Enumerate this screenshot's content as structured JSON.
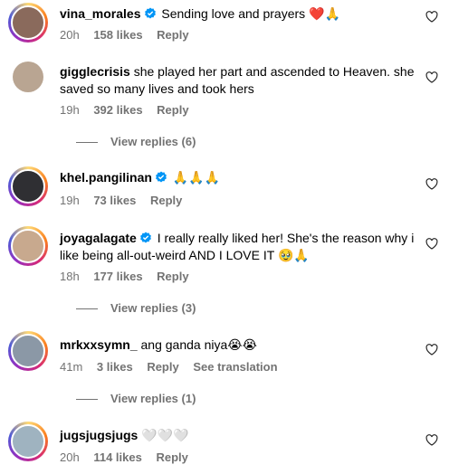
{
  "comments": [
    {
      "username": "vina_morales",
      "verified": true,
      "text": "Sending love and prayers",
      "emoji": "❤️🙏",
      "time": "20h",
      "likes": "158 likes",
      "reply": "Reply",
      "story_ring": true,
      "avatar_color": "#8a6a5c"
    },
    {
      "username": "gigglecrisis",
      "verified": false,
      "text": "she played her part and ascended to Heaven. she saved so many lives and took hers",
      "emoji": "",
      "time": "19h",
      "likes": "392 likes",
      "reply": "Reply",
      "story_ring": false,
      "avatar_color": "#b9a592"
    },
    {
      "username": "khel.pangilinan",
      "verified": true,
      "text": "",
      "emoji": "🙏🙏🙏",
      "time": "19h",
      "likes": "73 likes",
      "reply": "Reply",
      "story_ring": true,
      "avatar_color": "#2f2f33"
    },
    {
      "username": "joyagalagate",
      "verified": true,
      "text": "I really really liked her! She's the reason why i like being all-out-weird AND I LOVE IT",
      "emoji": "🥹🙏",
      "time": "18h",
      "likes": "177 likes",
      "reply": "Reply",
      "story_ring": true,
      "avatar_color": "#c8a98e"
    },
    {
      "username": "mrkxxsymn_",
      "verified": false,
      "text": "ang ganda niya",
      "emoji": "😭😭",
      "time": "41m",
      "likes": "3 likes",
      "reply": "Reply",
      "see_translation": "See translation",
      "story_ring": true,
      "avatar_color": "#8b98a6"
    },
    {
      "username": "jugsjugsjugs",
      "verified": false,
      "text": "",
      "emoji": "🤍🤍🤍",
      "time": "20h",
      "likes": "114 likes",
      "reply": "Reply",
      "story_ring": true,
      "avatar_color": "#9fb3c0"
    }
  ],
  "view_replies": {
    "r1": "View replies (6)",
    "r2": "View replies (3)",
    "r3": "View replies (1)"
  },
  "icons": {
    "heart": "heart-outline-icon",
    "verified": "verified-badge-icon"
  },
  "colors": {
    "verified_blue": "#0095f6",
    "muted_text": "#737373"
  }
}
